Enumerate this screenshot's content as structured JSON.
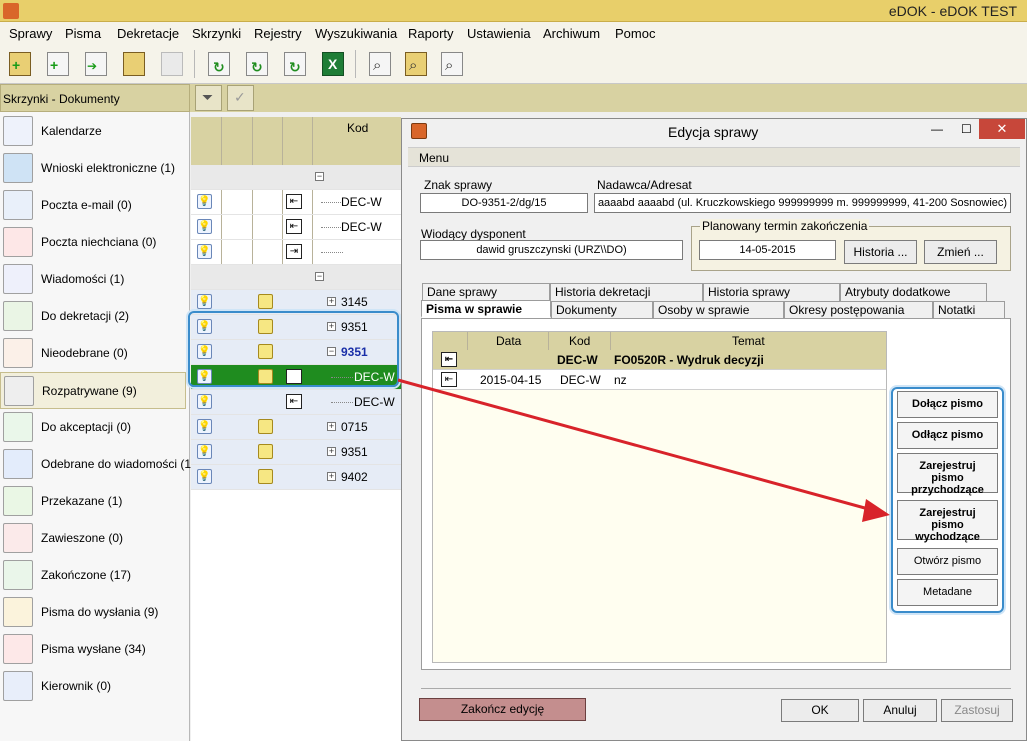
{
  "app": {
    "title": "eDOK - eDOK TEST"
  },
  "menubar": {
    "items": [
      "Sprawy",
      "Pisma",
      "Dekretacje",
      "Skrzynki",
      "Rejestry",
      "Wyszukiwania",
      "Raporty",
      "Ustawienia",
      "Archiwum",
      "Pomoc"
    ]
  },
  "left_panel": {
    "header": "Skrzynki - Dokumenty",
    "items": [
      {
        "label": "Kalendarze",
        "icon": "calendar-icon"
      },
      {
        "label": "Wnioski elektroniczne (1)",
        "icon": "globe-icon"
      },
      {
        "label": "Poczta e-mail (0)",
        "icon": "email-icon"
      },
      {
        "label": "Poczta niechciana (0)",
        "icon": "no-entry-icon"
      },
      {
        "label": "Wiadomości (1)",
        "icon": "message-icon"
      },
      {
        "label": "Do dekretacji (2)",
        "icon": "tree-icon"
      },
      {
        "label": "Nieodebrane (0)",
        "icon": "mailbox-icon"
      },
      {
        "label": "Rozpatrywane (9)",
        "icon": "gear-icon"
      },
      {
        "label": "Do akceptacji (0)",
        "icon": "checkmark-icon"
      },
      {
        "label": "Odebrane do wiadomości (1)",
        "icon": "info-icon"
      },
      {
        "label": "Przekazane (1)",
        "icon": "arrow-left-icon"
      },
      {
        "label": "Zawieszone (0)",
        "icon": "suspended-icon"
      },
      {
        "label": "Zakończone (17)",
        "icon": "gear-check-icon"
      },
      {
        "label": "Pisma do wysłania (9)",
        "icon": "outbox-icon"
      },
      {
        "label": "Pisma wysłane (34)",
        "icon": "sent-icon"
      },
      {
        "label": "Kierownik (0)",
        "icon": "manager-icon"
      }
    ]
  },
  "grid": {
    "column_kod": "Kod",
    "rows": [
      {
        "text": "",
        "kind": "group"
      },
      {
        "text": "DEC-W",
        "kind": "child"
      },
      {
        "text": "DEC-W",
        "kind": "child"
      },
      {
        "text": "",
        "kind": "child-empty"
      },
      {
        "text": "",
        "kind": "group"
      },
      {
        "text": "3145",
        "kind": "node"
      },
      {
        "text": "9351",
        "kind": "node"
      },
      {
        "text": "9351",
        "kind": "node-open"
      },
      {
        "text": "DEC-W",
        "kind": "child-sel"
      },
      {
        "text": "DEC-W",
        "kind": "child"
      },
      {
        "text": "0715",
        "kind": "node"
      },
      {
        "text": "9351",
        "kind": "node"
      },
      {
        "text": "9402",
        "kind": "node"
      }
    ]
  },
  "dialog": {
    "title": "Edycja sprawy",
    "menu": "Menu",
    "znak_label": "Znak sprawy",
    "znak_value": "DO-9351-2/dg/15",
    "nadawca_label": "Nadawca/Adresat",
    "nadawca_value": "aaaabd aaaabd (ul. Kruczkowskiego 999999999 m. 999999999, 41-200 Sosnowiec)",
    "wiodacy_label": "Wiodący dysponent",
    "wiodacy_value": "dawid gruszczynski (URZ\\\\DO)",
    "termin_label": "Planowany termin zakończenia",
    "termin_value": "14-05-2015",
    "historia_btn": "Historia ...",
    "zmien_btn": "Zmień ...",
    "tabs_row1": [
      "Dane sprawy",
      "Historia dekretacji",
      "Historia sprawy",
      "Atrybuty dodatkowe"
    ],
    "tabs_row2": [
      "Pisma w sprawie",
      "Dokumenty",
      "Osoby w sprawie",
      "Okresy postępowania",
      "Notatki"
    ],
    "list": {
      "headers": [
        "Data",
        "Kod",
        "Temat"
      ],
      "rows": [
        {
          "data": "",
          "kod": "DEC-W",
          "temat": "FO0520R - Wydruk decyzji"
        },
        {
          "data": "2015-04-15",
          "kod": "DEC-W",
          "temat": "nz"
        }
      ]
    },
    "side_buttons": [
      "Dołącz pismo",
      "Odłącz pismo",
      "Zarejestruj pismo przychodzące",
      "Zarejestruj pismo wychodzące",
      "Otwórz pismo",
      "Metadane"
    ],
    "finish_btn": "Zakończ edycję",
    "ok_btn": "OK",
    "cancel_btn": "Anuluj",
    "apply_btn": "Zastosuj"
  },
  "colors": {
    "title_bar": "#e8cf6a",
    "selected_row": "#1f8c1f",
    "highlight": "#3a8ccb",
    "arrow": "#d8232a"
  }
}
